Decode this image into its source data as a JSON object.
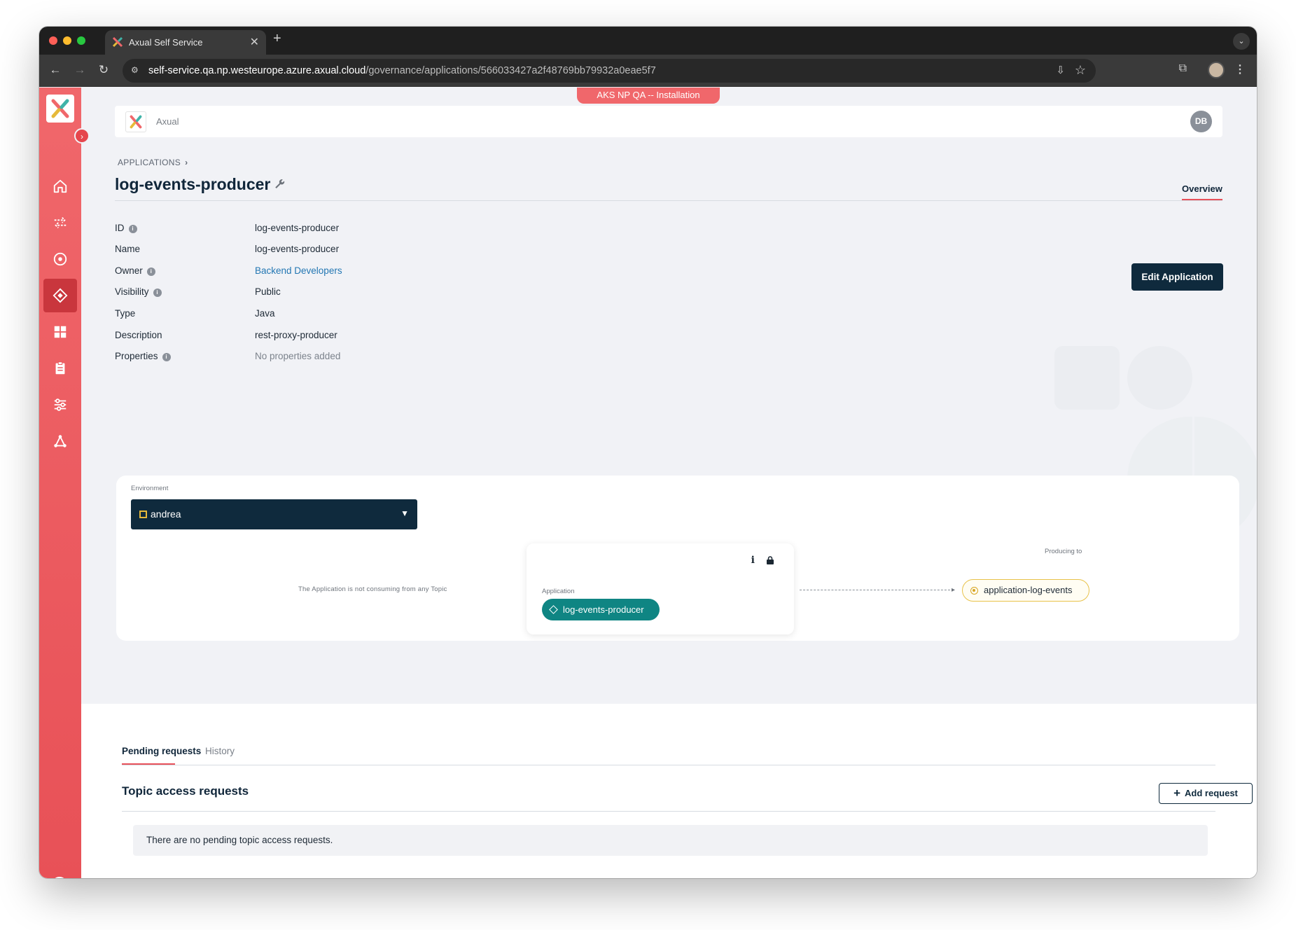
{
  "browser": {
    "tab_title": "Axual Self Service",
    "new_tab": "+",
    "close": "✕",
    "url_host": "self-service.qa.np.westeurope.azure.axual.cloud",
    "url_path": "/governance/applications/566033427a2f48769bb79932a0eae5f7"
  },
  "env_banner": "AKS NP QA -- Installation",
  "topbar": {
    "brand": "Axual",
    "user_initials": "DB"
  },
  "breadcrumb": {
    "label": "APPLICATIONS"
  },
  "page": {
    "title": "log-events-producer",
    "tab": "Overview"
  },
  "details": [
    {
      "label": "ID",
      "value": "log-events-producer",
      "info": true
    },
    {
      "label": "Name",
      "value": "log-events-producer",
      "info": false
    },
    {
      "label": "Owner",
      "value": "Backend Developers",
      "info": true
    },
    {
      "label": "Visibility",
      "value": "Public",
      "info": true
    },
    {
      "label": "Type",
      "value": "Java",
      "info": false
    },
    {
      "label": "Description",
      "value": "rest-proxy-producer",
      "info": false
    },
    {
      "label": "Properties",
      "value": "No properties added",
      "info": true
    }
  ],
  "edit_button": "Edit Application",
  "environment": {
    "label": "Environment",
    "selected": "andrea",
    "no_consume": "The Application is not consuming from any Topic",
    "app_label": "Application",
    "app_name": "log-events-producer",
    "producing_label": "Producing to",
    "topic": "application-log-events"
  },
  "lower": {
    "tabs": [
      "Pending requests",
      "History"
    ],
    "section_title": "Topic access requests",
    "add_button": "Add request",
    "empty_text": "There are no pending topic access requests."
  },
  "colors": {
    "sidebar": "#f0676b",
    "primary": "#0f2a3d",
    "accent": "#e8515a",
    "app_pill": "#0f8583",
    "topic_border": "#e8c24a"
  }
}
